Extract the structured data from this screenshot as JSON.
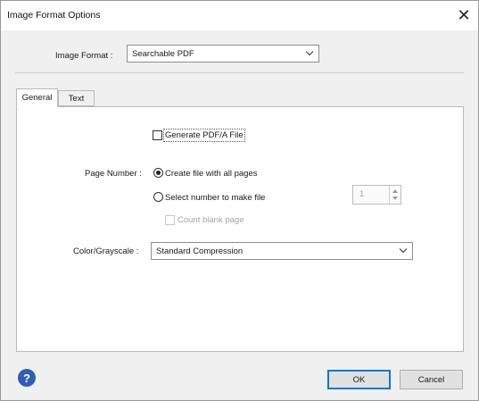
{
  "window": {
    "title": "Image Format Options",
    "close_glyph": "✕"
  },
  "image_format": {
    "label": "Image Format :",
    "value": "Searchable PDF"
  },
  "tabs": [
    {
      "label": "General",
      "active": true
    },
    {
      "label": "Text",
      "active": false
    }
  ],
  "general": {
    "generate_pdfa": {
      "label": "Generate PDF/A File",
      "checked": false
    },
    "page_number": {
      "label": "Page Number :",
      "options": [
        {
          "label": "Create file with all pages",
          "selected": true
        },
        {
          "label": "Select number to make file",
          "selected": false
        }
      ],
      "number_value": "1",
      "count_blank": {
        "label": "Count blank page",
        "checked": false,
        "enabled": false
      }
    },
    "color": {
      "label": "Color/Grayscale :",
      "value": "Standard Compression"
    }
  },
  "footer": {
    "help_icon": "question-circle-icon",
    "help_glyph": "?",
    "ok_label": "OK",
    "cancel_label": "Cancel"
  },
  "colors": {
    "accent": "#0078d7",
    "help_icon": "#2f5fb3"
  }
}
